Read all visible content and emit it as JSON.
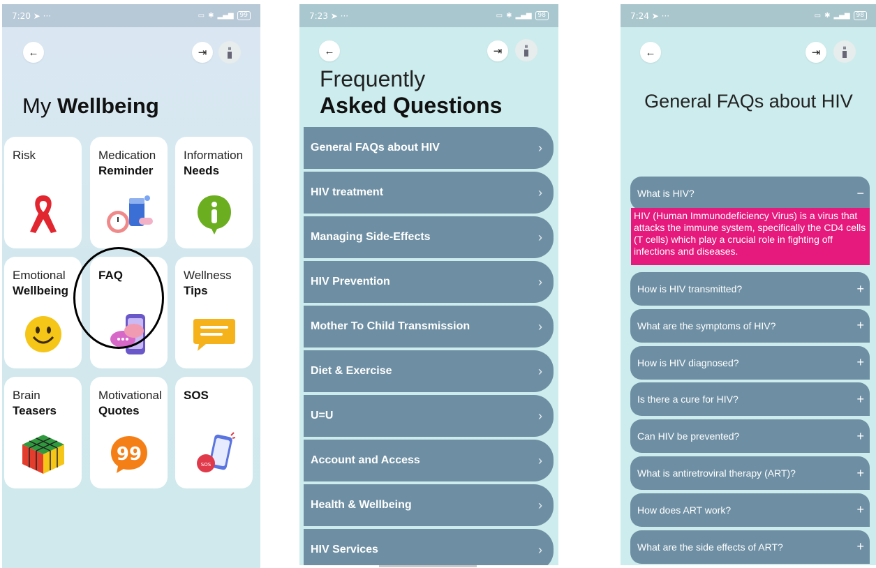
{
  "screens": [
    {
      "status": {
        "time": "7:20",
        "battery": "99"
      },
      "title_light": "My",
      "title_bold": "Wellbeing",
      "tiles": [
        {
          "line1": "Risk",
          "line2": "",
          "icon": "red-ribbon-icon"
        },
        {
          "line1": "Medication",
          "line2": "Reminder",
          "icon": "pills-clock-icon"
        },
        {
          "line1": "Information",
          "line2": "Needs",
          "icon": "info-icon"
        },
        {
          "line1": "Emotional",
          "line2": "Wellbeing",
          "icon": "smiley-icon"
        },
        {
          "line1": "",
          "line2": "FAQ",
          "icon": "chat-phone-icon"
        },
        {
          "line1": "Wellness",
          "line2": "Tips",
          "icon": "message-icon"
        },
        {
          "line1": "Brain",
          "line2": "Teasers",
          "icon": "rubiks-cube-icon"
        },
        {
          "line1": "Motivational",
          "line2": "Quotes",
          "icon": "quote-icon"
        },
        {
          "line1": "",
          "line2": "SOS",
          "icon": "sos-phone-icon"
        }
      ]
    },
    {
      "status": {
        "time": "7:23",
        "battery": "98"
      },
      "title_line1": "Frequently",
      "title_line2": "Asked Questions",
      "categories": [
        "General FAQs about HIV",
        "HIV treatment",
        "Managing Side-Effects",
        "HIV Prevention",
        "Mother To Child Transmission",
        "Diet & Exercise",
        "U=U",
        "Account and Access",
        "Health & Wellbeing",
        "HIV Services"
      ]
    },
    {
      "status": {
        "time": "7:24",
        "battery": "98"
      },
      "title": "General FAQs about HIV",
      "expanded": {
        "question": "What is HIV?",
        "answer": "HIV (Human Immunodeficiency Virus) is a virus that attacks the immune system, specifically the CD4 cells (T cells) which play a crucial role in fighting off infections and diseases."
      },
      "questions": [
        "How is HIV transmitted?",
        "What are the symptoms of HIV?",
        "How is HIV diagnosed?",
        "Is there a cure for HIV?",
        "Can HIV be prevented?",
        "What is antiretroviral therapy (ART)?",
        "How does ART work?",
        "What are the side effects of ART?"
      ]
    }
  ],
  "colors": {
    "accent_row": "#6e8fa3",
    "answer_bg": "#e6197d"
  }
}
